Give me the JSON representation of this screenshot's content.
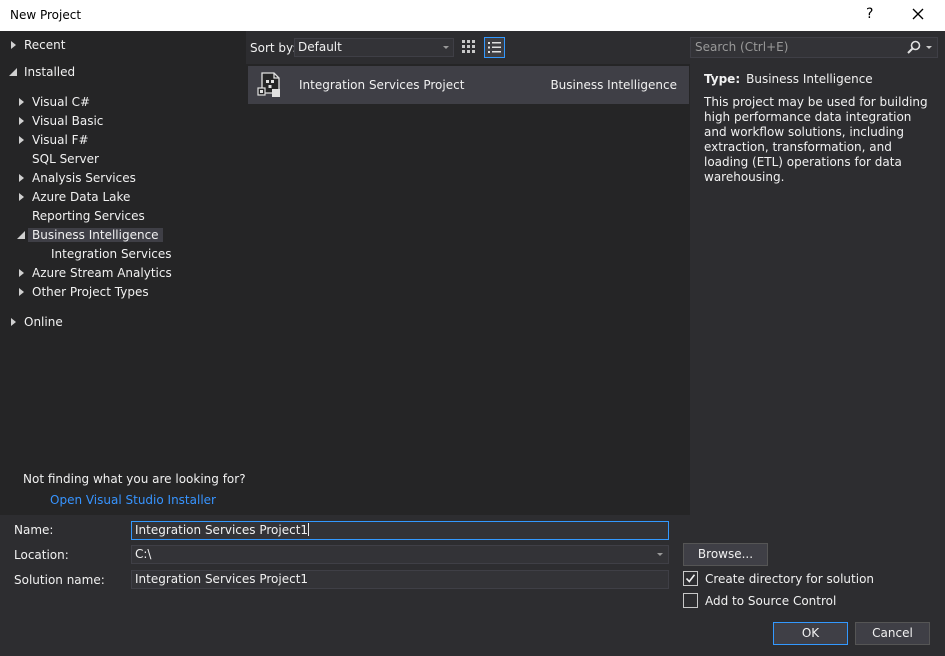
{
  "window": {
    "title": "New Project",
    "help": "?"
  },
  "tree": {
    "recent": "Recent",
    "installed": "Installed",
    "items": [
      "Visual C#",
      "Visual Basic",
      "Visual F#",
      "SQL Server",
      "Analysis Services",
      "Azure Data Lake",
      "Reporting Services",
      "Business Intelligence",
      "Integration Services",
      "Azure Stream Analytics",
      "Other Project Types"
    ],
    "online": "Online",
    "selected": "Business Intelligence"
  },
  "helpers": {
    "not_finding": "Not finding what you are looking for?",
    "installer_link": "Open Visual Studio Installer"
  },
  "toolbar": {
    "sort_label": "Sort by:",
    "sort_value": "Default"
  },
  "search": {
    "placeholder": "Search (Ctrl+E)"
  },
  "templates": [
    {
      "name": "Integration Services Project",
      "category": "Business Intelligence"
    }
  ],
  "details": {
    "type_label": "Type:",
    "type_value": "Business Intelligence",
    "description": "This project may be used for building high performance data integration and workflow solutions, including extraction, transformation, and loading (ETL) operations for data warehousing."
  },
  "form": {
    "name_label": "Name:",
    "name_value": "Integration Services Project1",
    "location_label": "Location:",
    "location_value": "C:\\",
    "solution_label": "Solution name:",
    "solution_value": "Integration Services Project1",
    "browse": "Browse...",
    "create_dir": "Create directory for solution",
    "create_dir_checked": true,
    "source_control": "Add to Source Control",
    "source_control_checked": false
  },
  "buttons": {
    "ok": "OK",
    "cancel": "Cancel"
  },
  "colors": {
    "accent": "#3399ff",
    "link": "#3794ff",
    "background": "#2d2d30",
    "pane": "#252526"
  }
}
